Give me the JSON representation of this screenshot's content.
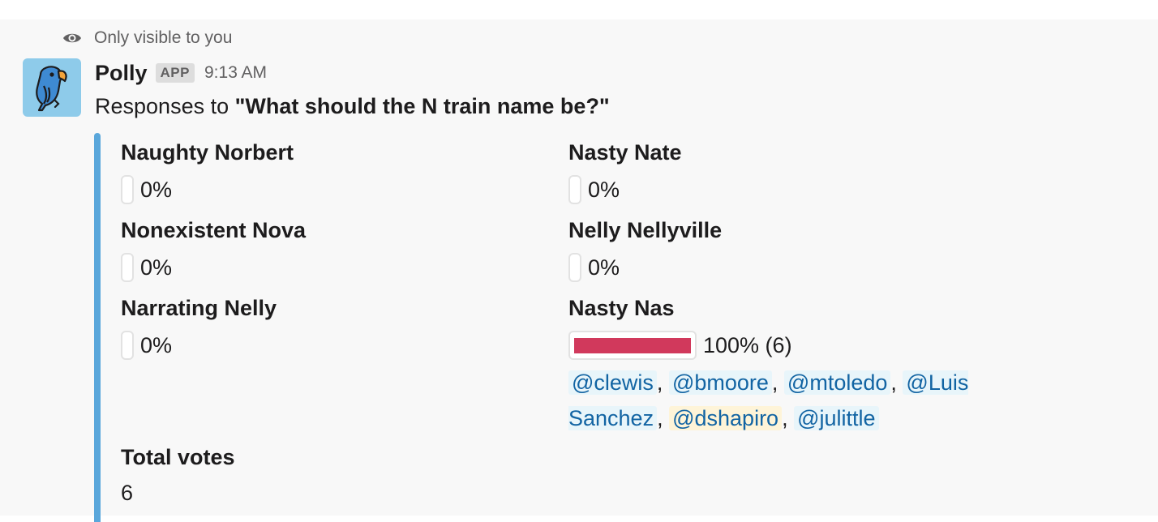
{
  "ephemeral_notice": "Only visible to you",
  "message": {
    "sender": "Polly",
    "badge": "APP",
    "time": "9:13 AM",
    "intro": "Responses to ",
    "question": "\"What should the N train name be?\""
  },
  "poll": {
    "options": [
      {
        "name": "Naughty Norbert",
        "result": "0%",
        "percent": 0
      },
      {
        "name": "Nasty Nate",
        "result": "0%",
        "percent": 0
      },
      {
        "name": "Nonexistent Nova",
        "result": "0%",
        "percent": 0
      },
      {
        "name": "Nelly Nellyville",
        "result": "0%",
        "percent": 0
      },
      {
        "name": "Narrating Nelly",
        "result": "0%",
        "percent": 0
      },
      {
        "name": "Nasty Nas",
        "result": "100% (6)",
        "percent": 100
      }
    ],
    "voters": [
      "@clewis",
      "@bmoore",
      "@mtoledo",
      "@Luis Sanchez",
      "@dshapiro",
      "@julittle"
    ],
    "separator": ", ",
    "total_label": "Total votes",
    "total_value": "6"
  },
  "colors": {
    "accent_bar": "#5aa7db",
    "progress_fill": "#d1395c",
    "mention": "#1264a3",
    "avatar_bg": "#8ecbea"
  },
  "icons": {
    "ephemeral": "eye-icon",
    "avatar": "parrot-icon"
  }
}
